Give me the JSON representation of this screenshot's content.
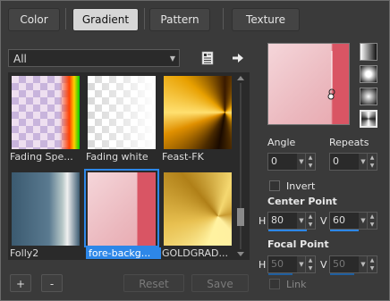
{
  "tabs": [
    {
      "label": "Color"
    },
    {
      "label": "Gradient"
    },
    {
      "label": "Pattern"
    },
    {
      "label": "Texture"
    }
  ],
  "filter": {
    "selected": "All"
  },
  "gallery": {
    "items": [
      {
        "label": "Fading Spe..."
      },
      {
        "label": "Fading white"
      },
      {
        "label": "Feast-FK"
      },
      {
        "label": "Folly2"
      },
      {
        "label": "fore-backg..."
      },
      {
        "label": "GOLDGRAD..."
      }
    ],
    "selected_index": 4
  },
  "bottom_buttons": {
    "add": "+",
    "remove": "-",
    "reset": "Reset",
    "save": "Save"
  },
  "angle": {
    "label": "Angle",
    "value": "0"
  },
  "repeats": {
    "label": "Repeats",
    "value": "0"
  },
  "invert": {
    "label": "Invert",
    "checked": false
  },
  "center_point": {
    "label": "Center Point",
    "h_label": "H",
    "h": "80",
    "v_label": "V",
    "v": "60"
  },
  "focal_point": {
    "label": "Focal Point",
    "h_label": "H",
    "h": "50",
    "v_label": "V",
    "v": "50"
  },
  "link": {
    "label": "Link",
    "checked": false
  },
  "colors": {
    "accent": "#2d87e8",
    "panel": "#3a3a3a",
    "preview_light": "#f5d6da",
    "preview_red": "#d95564"
  },
  "style_buttons": [
    "linear-gradient-icon",
    "rectangular-gradient-icon",
    "radial-gradient-icon",
    "sunburst-gradient-icon"
  ]
}
